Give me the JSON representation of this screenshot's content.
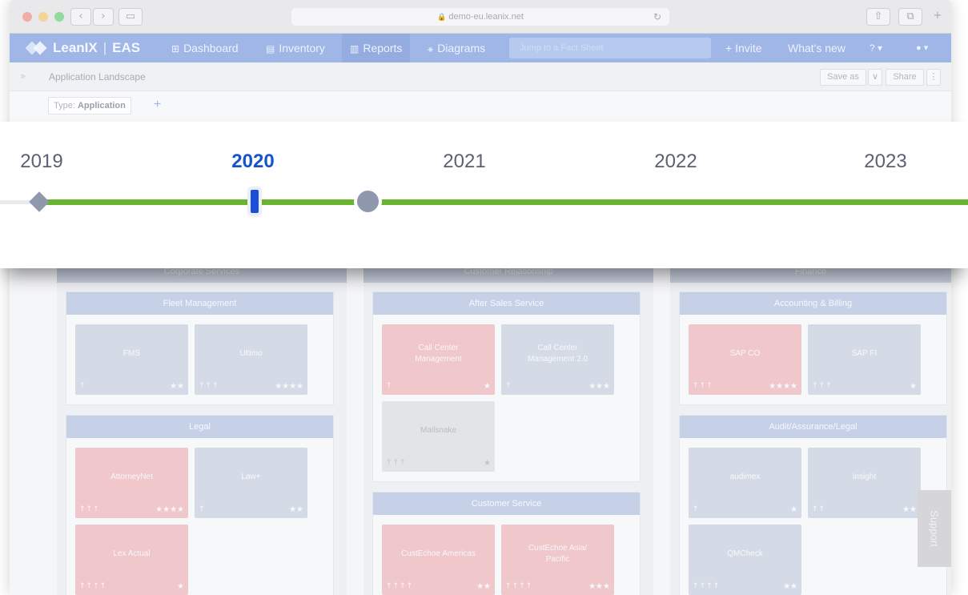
{
  "browser": {
    "url": "demo-eu.leanix.net",
    "nav_back": "‹",
    "nav_forward": "›",
    "sidebar_icon": "▭",
    "share_icon": "⇧",
    "tabs_icon": "⧉",
    "new_tab": "+"
  },
  "app": {
    "brand": "LeanIX",
    "product": "EAS",
    "nav": [
      {
        "label": "Dashboard",
        "icon": "⊞"
      },
      {
        "label": "Inventory",
        "icon": "▤"
      },
      {
        "label": "Reports",
        "icon": "▥"
      },
      {
        "label": "Diagrams",
        "icon": "⚹"
      }
    ],
    "search_placeholder": "Jump to a Fact Sheet",
    "invite": "+ Invite",
    "whats_new": "What's new",
    "help": "? ▾",
    "user": "● ▾"
  },
  "report": {
    "title": "Application Landscape",
    "save_as": "Save as",
    "save_dropdown": "∨",
    "share": "Share",
    "more": "⋮",
    "filter_label": "Type: ",
    "filter_value": "Application",
    "add_filter": "+"
  },
  "timeline": {
    "years": [
      "2019",
      "2020",
      "2021",
      "2022",
      "2023"
    ],
    "selected_year": "2020"
  },
  "landscape": {
    "columns": [
      {
        "title": "Corporate Services",
        "groups": [
          {
            "title": "Fleet Management",
            "cards": [
              {
                "name": "FMS",
                "arrows": "↑",
                "stars": "★★",
                "color": "grey"
              },
              {
                "name": "Ultimo",
                "arrows": "↑↑↑",
                "stars": "★★★★",
                "color": "grey"
              }
            ]
          },
          {
            "title": "Legal",
            "cards": [
              {
                "name": "AttorneyNet",
                "arrows": "↑↑↑",
                "stars": "★★★★",
                "color": "pink"
              },
              {
                "name": "Law+",
                "arrows": "↑",
                "stars": "★★",
                "color": "grey"
              },
              {
                "name": "Lex Actual",
                "arrows": "↑↑↑↑",
                "stars": "★",
                "color": "pink"
              }
            ]
          }
        ]
      },
      {
        "title": "Customer Relationship",
        "groups": [
          {
            "title": "After Sales Service",
            "cards": [
              {
                "name": "Call Center Management",
                "arrows": "↑",
                "stars": "★",
                "color": "pink"
              },
              {
                "name": "Call Center Management 2.0",
                "arrows": "↑",
                "stars": "★★★",
                "color": "grey"
              },
              {
                "name": "Mailsnake",
                "arrows": "↑↑↑",
                "stars": "★",
                "color": "light"
              }
            ]
          },
          {
            "title": "Customer Service",
            "cards": [
              {
                "name": "CustEchoe Americas",
                "arrows": "↑↑↑↑",
                "stars": "★★",
                "color": "pink"
              },
              {
                "name": "CustEchoe Asia/ Pacific",
                "arrows": "↑↑↑↑",
                "stars": "★★★",
                "color": "pink"
              }
            ]
          }
        ]
      },
      {
        "title": "Finance",
        "groups": [
          {
            "title": "Accounting & Billing",
            "cards": [
              {
                "name": "SAP CO",
                "arrows": "↑↑↑",
                "stars": "★★★★",
                "color": "pink"
              },
              {
                "name": "SAP FI",
                "arrows": "↑↑↑",
                "stars": "★",
                "color": "grey"
              }
            ]
          },
          {
            "title": "Audit/Assurance/Legal",
            "cards": [
              {
                "name": "audimex",
                "arrows": "↑",
                "stars": "★",
                "color": "grey"
              },
              {
                "name": "Insight",
                "arrows": "↑↑",
                "stars": "★★",
                "color": "grey"
              },
              {
                "name": "QMCheck",
                "arrows": "↑↑↑↑",
                "stars": "★★",
                "color": "grey"
              }
            ]
          }
        ]
      }
    ]
  },
  "support_label": "Support",
  "colors": {
    "timeline_line": "#6ab42f",
    "selected_year": "#1753c9",
    "navbar": "#9fb6e6",
    "card_pink": "#f0c7cb",
    "card_grey": "#d5dbe6"
  }
}
